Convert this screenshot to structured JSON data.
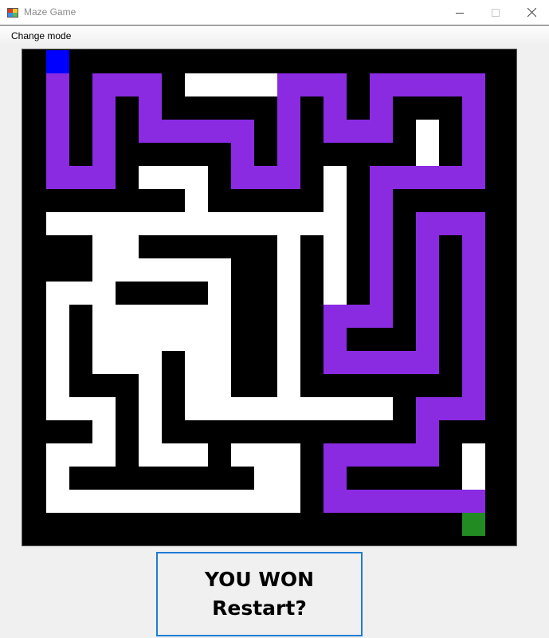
{
  "window": {
    "title": "Maze Game",
    "controls": [
      "minimize",
      "maximize",
      "close"
    ]
  },
  "menu": {
    "items": [
      {
        "label": "Change mode"
      }
    ]
  },
  "maze": {
    "grid_cols": 20,
    "colors": {
      "wall": "#000000",
      "floor": "#ffffff",
      "path": "#8a2be2",
      "start": "#0000ff",
      "goal": "#228b22"
    },
    "start_cell": [
      0,
      0
    ],
    "goal_cell": [
      19,
      20
    ]
  },
  "restart": {
    "line1": "YOU WON",
    "line2": "Restart?"
  }
}
